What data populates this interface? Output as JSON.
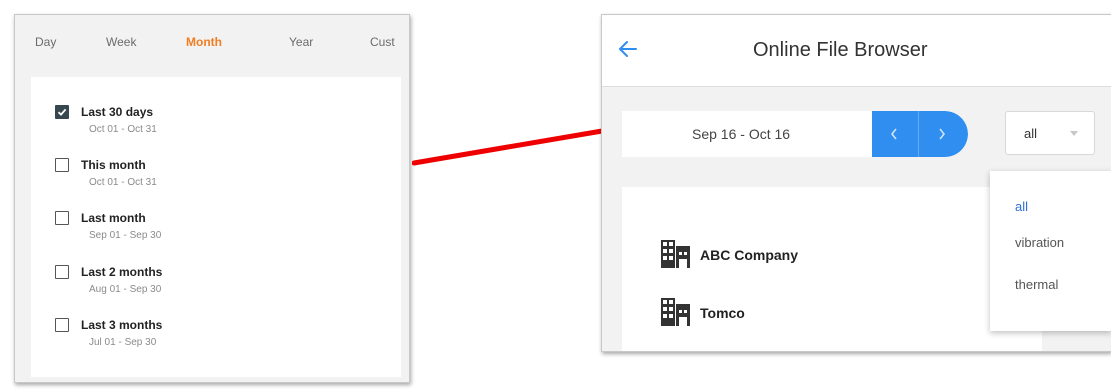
{
  "period_tabs": [
    {
      "label": "Day"
    },
    {
      "label": "Week"
    },
    {
      "label": "Month",
      "active": true
    },
    {
      "label": "Year"
    },
    {
      "label": "Cust"
    }
  ],
  "range_options": [
    {
      "label": "Last 30 days",
      "dates": "Oct 01 - Oct 31",
      "checked": true
    },
    {
      "label": "This month",
      "dates": "Oct 01 - Oct 31",
      "checked": false
    },
    {
      "label": "Last month",
      "dates": "Sep 01 - Sep 30",
      "checked": false
    },
    {
      "label": "Last 2 months",
      "dates": "Aug 01 - Sep 30",
      "checked": false
    },
    {
      "label": "Last 3 months",
      "dates": "Jul 01 - Sep 30",
      "checked": false
    }
  ],
  "file_browser": {
    "title": "Online File Browser",
    "date_range": "Sep 16 - Oct 16",
    "filter": {
      "selected": "all",
      "options": [
        "all",
        "vibration",
        "thermal"
      ]
    },
    "companies": [
      {
        "name": "ABC Company"
      },
      {
        "name": "Tomco"
      }
    ]
  },
  "colors": {
    "accent_orange": "#f07d22",
    "accent_blue": "#2f8ef0",
    "arrow_red": "#ee0000",
    "selected_option": "#2f6fd6"
  }
}
